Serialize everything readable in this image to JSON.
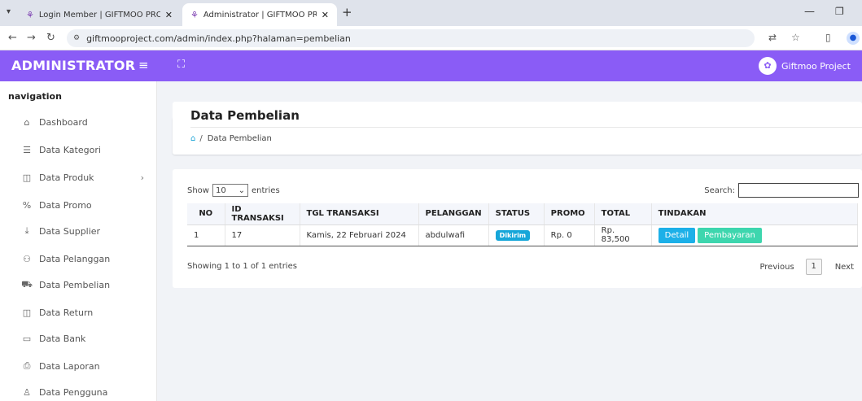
{
  "browser": {
    "tabs": [
      {
        "title": "Login Member | GIFTMOO PRO",
        "active": false
      },
      {
        "title": "Administrator | GIFTMOO PRO",
        "active": true
      }
    ],
    "url": "giftmooproject.com/admin/index.php?halaman=pembelian"
  },
  "header": {
    "brand": "ADMINISTRATOR",
    "user": "Giftmoo Project",
    "accent": "#8a5cf6"
  },
  "sidebar": {
    "heading": "navigation",
    "items": [
      {
        "label": "Dashboard",
        "icon": "home-icon"
      },
      {
        "label": "Data Kategori",
        "icon": "list-icon"
      },
      {
        "label": "Data Produk",
        "icon": "box-icon",
        "has_submenu": true
      },
      {
        "label": "Data Promo",
        "icon": "percent-icon"
      },
      {
        "label": "Data Supplier",
        "icon": "download-icon"
      },
      {
        "label": "Data Pelanggan",
        "icon": "users-icon"
      },
      {
        "label": "Data Pembelian",
        "icon": "cart-icon"
      },
      {
        "label": "Data Return",
        "icon": "box-icon"
      },
      {
        "label": "Data Bank",
        "icon": "card-icon"
      },
      {
        "label": "Data Laporan",
        "icon": "printer-icon"
      },
      {
        "label": "Data Pengguna",
        "icon": "user-icon"
      }
    ]
  },
  "page": {
    "title": "Data Pembelian",
    "breadcrumb": "Data Pembelian"
  },
  "table": {
    "show_label": "Show",
    "entries_value": "10",
    "entries_label": "entries",
    "search_label": "Search:",
    "search_value": "",
    "columns": [
      "NO",
      "ID TRANSAKSI",
      "TGL TRANSAKSI",
      "PELANGGAN",
      "STATUS",
      "PROMO",
      "TOTAL",
      "TINDAKAN"
    ],
    "rows": [
      {
        "no": "1",
        "id": "17",
        "date": "Kamis, 22 Februari 2024",
        "customer": "abdulwafi",
        "status": "Dikirim",
        "promo": "Rp. 0",
        "total": "Rp. 83,500",
        "actions": [
          "Detail",
          "Pembayaran"
        ]
      }
    ],
    "info": "Showing 1 to 1 of 1 entries",
    "pagination": {
      "previous": "Previous",
      "current": "1",
      "next": "Next"
    }
  }
}
